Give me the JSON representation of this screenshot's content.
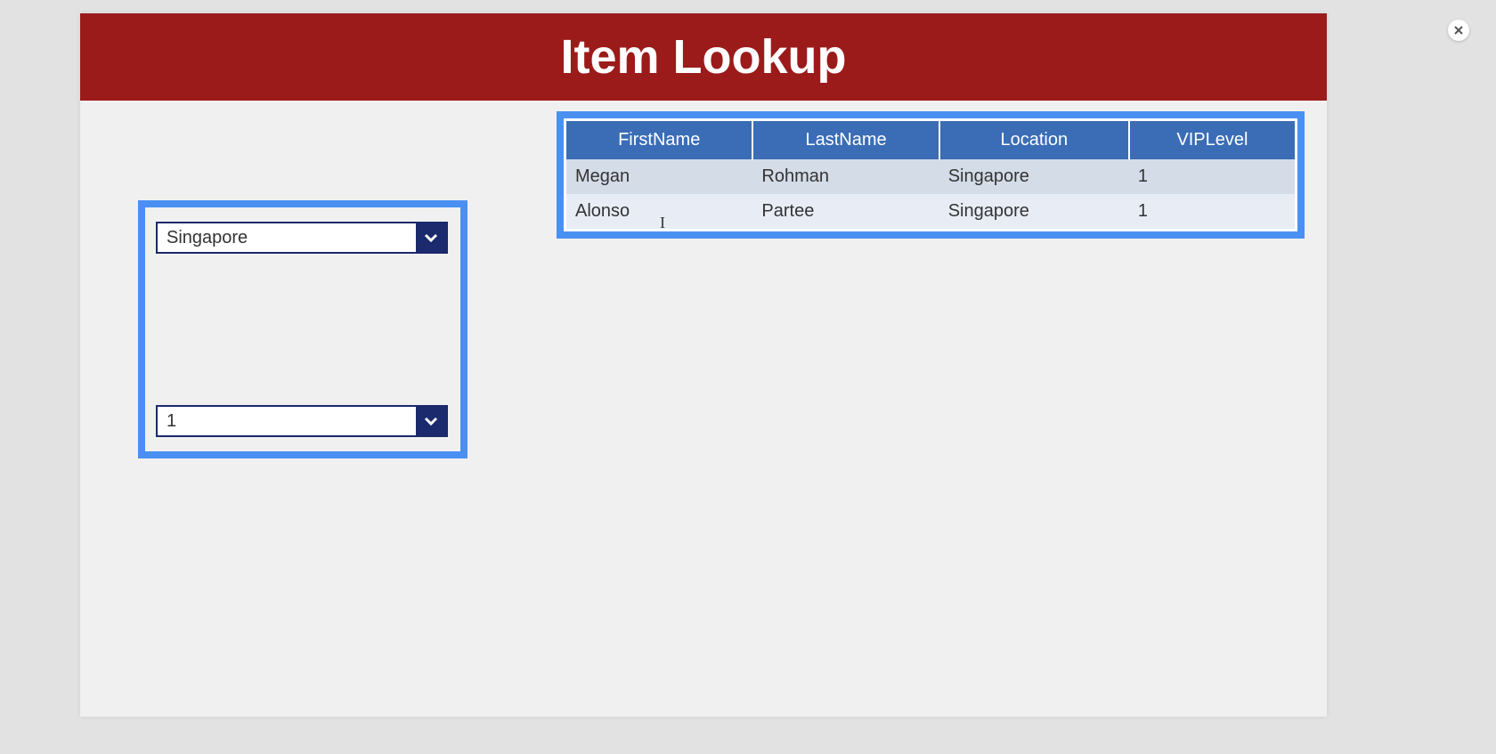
{
  "header": {
    "title": "Item Lookup"
  },
  "filters": {
    "location": {
      "selected": "Singapore"
    },
    "vip_level": {
      "selected": "1"
    }
  },
  "table": {
    "columns": [
      "FirstName",
      "LastName",
      "Location",
      "VIPLevel"
    ],
    "rows": [
      {
        "FirstName": "Megan",
        "LastName": "Rohman",
        "Location": "Singapore",
        "VIPLevel": "1"
      },
      {
        "FirstName": "Alonso",
        "LastName": "Partee",
        "Location": "Singapore",
        "VIPLevel": "1"
      }
    ]
  }
}
